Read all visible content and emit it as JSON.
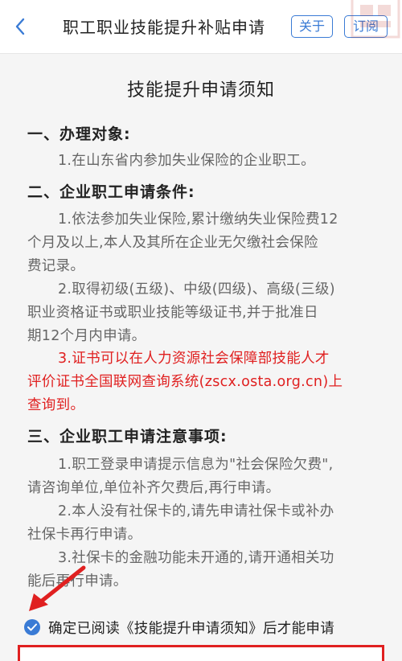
{
  "header": {
    "title": "职工职业技能提升补贴申请",
    "about_label": "关于",
    "subscribe_label": "订阅",
    "back_icon": "chevron-left-icon",
    "accent": "#3a7bd5"
  },
  "notice": {
    "title": "技能提升申请须知",
    "section1": {
      "heading": "一、办理对象:",
      "items": [
        "1.在山东省内参加失业保险的企业职工。"
      ]
    },
    "section2": {
      "heading": "二、企业职工申请条件:",
      "item1_line1": "1.依法参加失业保险,累计缴纳失业保险费12",
      "item1_line2": "个月及以上,本人及其所在企业无欠缴社会保险",
      "item1_line3": "费记录。",
      "item2_line1": "2.取得初级(五级)、中级(四级)、高级(三级)",
      "item2_line2": "职业资格证书或职业技能等级证书,并于批准日",
      "item2_line3": "期12个月内申请。",
      "item3_line1": "3.证书可以在人力资源社会保障部技能人才",
      "item3_line2": "评价证书全国联网查询系统(zscx.osta.org.cn)上",
      "item3_line3": "查询到。"
    },
    "section3": {
      "heading": "三、企业职工申请注意事项:",
      "item1_line1": "1.职工登录申请提示信息为\"社会保险欠费\",",
      "item1_line2": "请咨询单位,单位补齐欠费后,再行申请。",
      "item2_line1": "2.本人没有社保卡的,请先申请社保卡或补办",
      "item2_line2": "社保卡再行申请。",
      "item3_line1": "3.社保卡的金融功能未开通的,请开通相关功",
      "item3_line2": "能后再行申请。"
    }
  },
  "agreement": {
    "checked": true,
    "label": "确定已阅读《技能提升申请须知》后才能申请"
  },
  "colors": {
    "highlight": "#e02020",
    "text_muted": "#666666"
  }
}
